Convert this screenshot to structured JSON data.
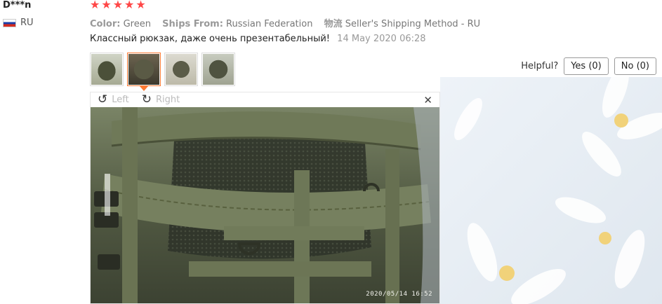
{
  "user": {
    "name": "D***n",
    "country": "RU"
  },
  "rating": {
    "stars": 5,
    "icon": "star-icon",
    "color": "#ff4747"
  },
  "attributes": {
    "color_label": "Color:",
    "color_value": "Green",
    "ships_label": "Ships From:",
    "ships_value": "Russian Federation",
    "logistics_label": "物流",
    "logistics_value": "Seller's Shipping Method - RU"
  },
  "review": {
    "text": "Классный рюкзак, даже очень презентабельный!",
    "date": "14 May 2020 06:28"
  },
  "thumbnails": {
    "count": 4,
    "selected_index": 1,
    "accent": "#ff7a33"
  },
  "helpful": {
    "label": "Helpful?",
    "yes": "Yes (0)",
    "no": "No (0)"
  },
  "viewer": {
    "rotate_left": "Left",
    "rotate_right": "Right",
    "rotate_left_icon": "rotate-left-icon",
    "rotate_right_icon": "rotate-right-icon",
    "close_icon": "close-icon",
    "timestamp": "2020/05/14 16:52"
  }
}
